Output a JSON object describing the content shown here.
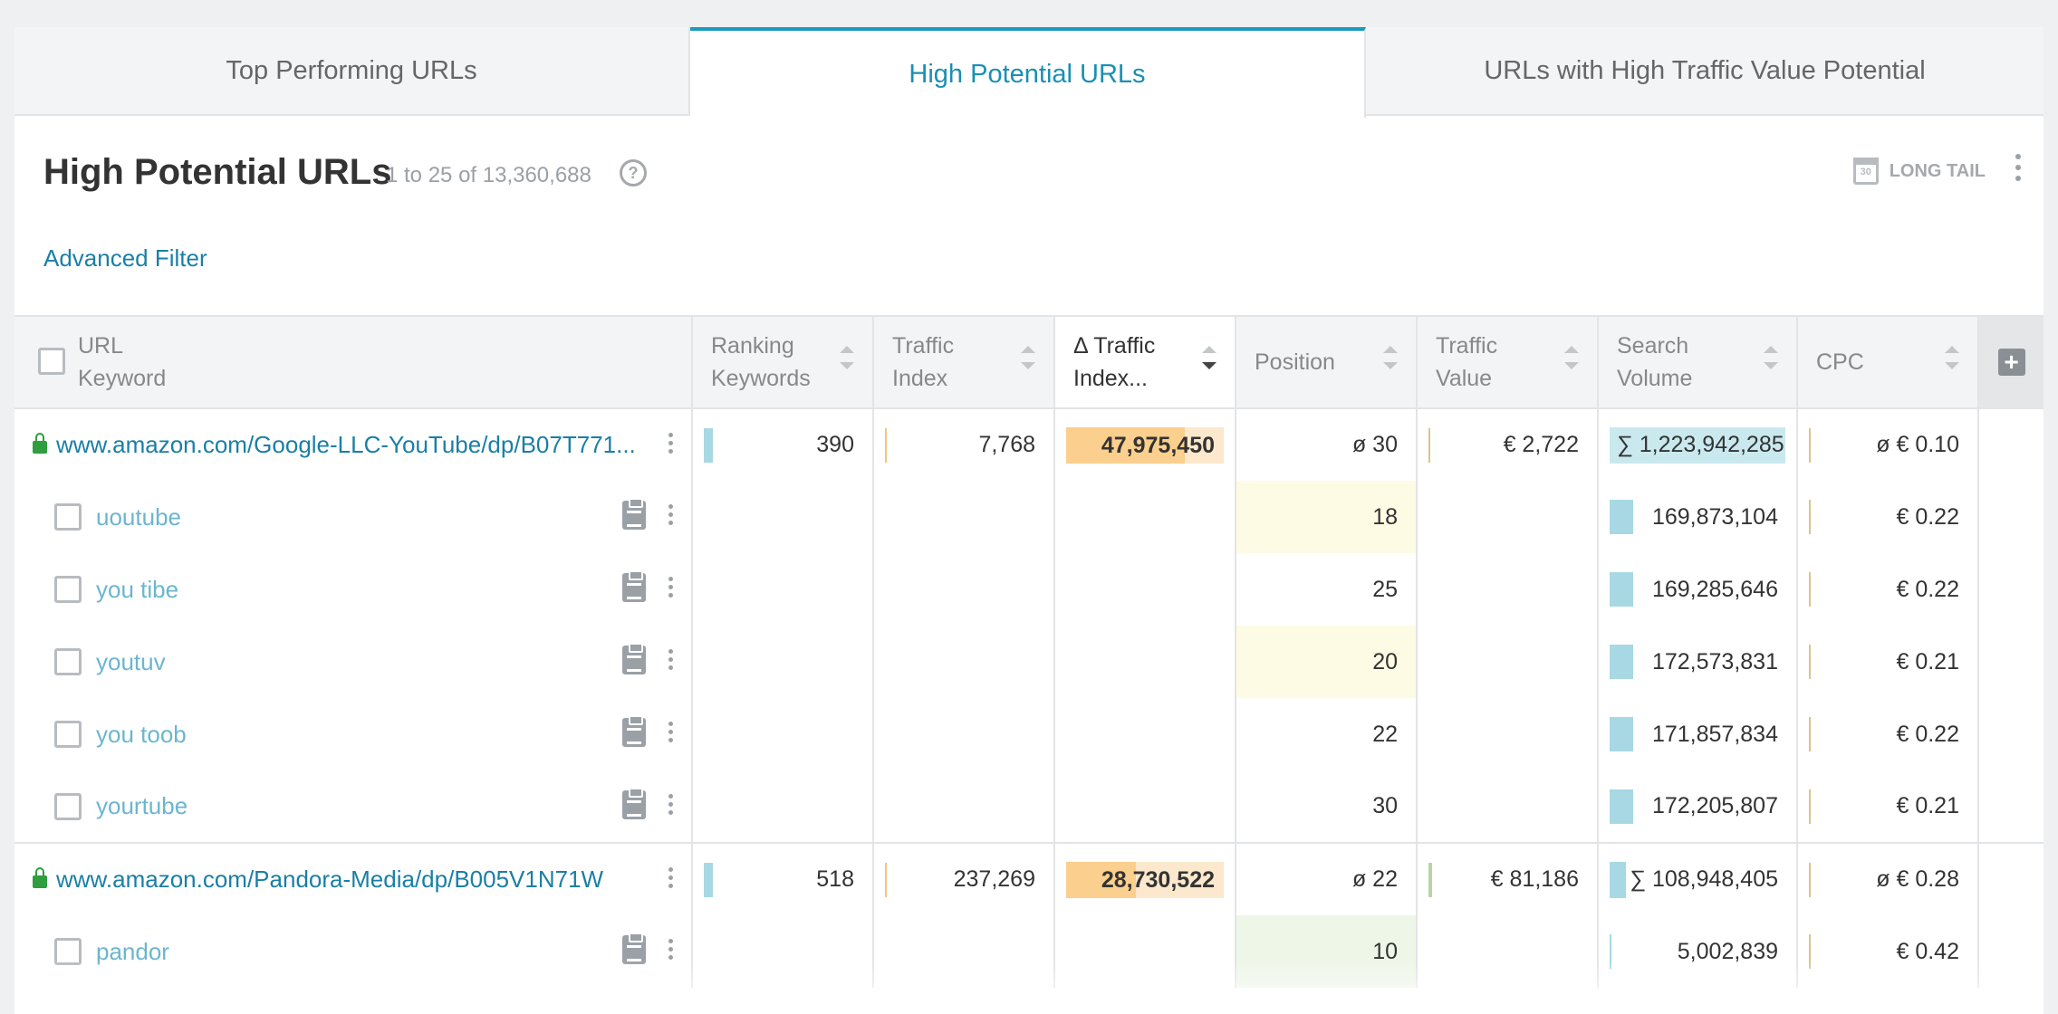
{
  "tabs": [
    {
      "label": "Top Performing URLs",
      "active": false
    },
    {
      "label": "High Potential URLs",
      "active": true
    },
    {
      "label": "URLs with High Traffic Value Potential",
      "active": false
    }
  ],
  "header": {
    "title": "High Potential URLs",
    "count": "1 to 25 of 13,360,688",
    "help": "?",
    "advanced_filter": "Advanced Filter",
    "calendar_day": "30",
    "long_tail": "LONG TAIL"
  },
  "columns": {
    "url": "URL",
    "keyword": "Keyword",
    "ranking_keywords": [
      "Ranking",
      "Keywords"
    ],
    "traffic_index": [
      "Traffic",
      "Index"
    ],
    "delta_traffic_index": [
      "Δ Traffic",
      "Index..."
    ],
    "position": "Position",
    "traffic_value": [
      "Traffic",
      "Value"
    ],
    "search_volume": [
      "Search",
      "Volume"
    ],
    "cpc": "CPC",
    "add_column": "+"
  },
  "groups": [
    {
      "url": "www.amazon.com/Google-LLC-YouTube/dp/B07T771...",
      "ranking_keywords": "390",
      "traffic_index": "7,768",
      "delta_traffic_index": "47,975,450",
      "delta_fill": 0.75,
      "position": "ø 30",
      "traffic_value": "€ 2,722",
      "search_volume": "∑ 1,223,942,285",
      "cpc": "ø € 0.10",
      "keywords": [
        {
          "keyword": "uoutube",
          "position": "18",
          "search_volume": "169,873,104",
          "cpc": "€ 0.22",
          "pos_tint": "yellow"
        },
        {
          "keyword": "you tibe",
          "position": "25",
          "search_volume": "169,285,646",
          "cpc": "€ 0.22",
          "pos_tint": "none"
        },
        {
          "keyword": "youtuv",
          "position": "20",
          "search_volume": "172,573,831",
          "cpc": "€ 0.21",
          "pos_tint": "yellow"
        },
        {
          "keyword": "you toob",
          "position": "22",
          "search_volume": "171,857,834",
          "cpc": "€ 0.22",
          "pos_tint": "none"
        },
        {
          "keyword": "yourtube",
          "position": "30",
          "search_volume": "172,205,807",
          "cpc": "€ 0.21",
          "pos_tint": "none"
        }
      ]
    },
    {
      "url": "www.amazon.com/Pandora-Media/dp/B005V1N71W",
      "ranking_keywords": "518",
      "traffic_index": "237,269",
      "delta_traffic_index": "28,730,522",
      "delta_fill": 0.44,
      "position": "ø 22",
      "traffic_value": "€ 81,186",
      "search_volume": "∑ 108,948,405",
      "cpc": "ø € 0.28",
      "keywords": [
        {
          "keyword": "pandor",
          "position": "10",
          "search_volume": "5,002,839",
          "cpc": "€ 0.42",
          "pos_tint": "green"
        }
      ]
    }
  ],
  "colors": {
    "accent": "#1a9bbf",
    "link": "#1a7fa6",
    "keyword": "#6bb6cf",
    "bar": "#a7d8e3",
    "delta_bg": "#fbe8cd",
    "delta_fill": "#fbcf8d",
    "lock": "#2e9e3e"
  }
}
